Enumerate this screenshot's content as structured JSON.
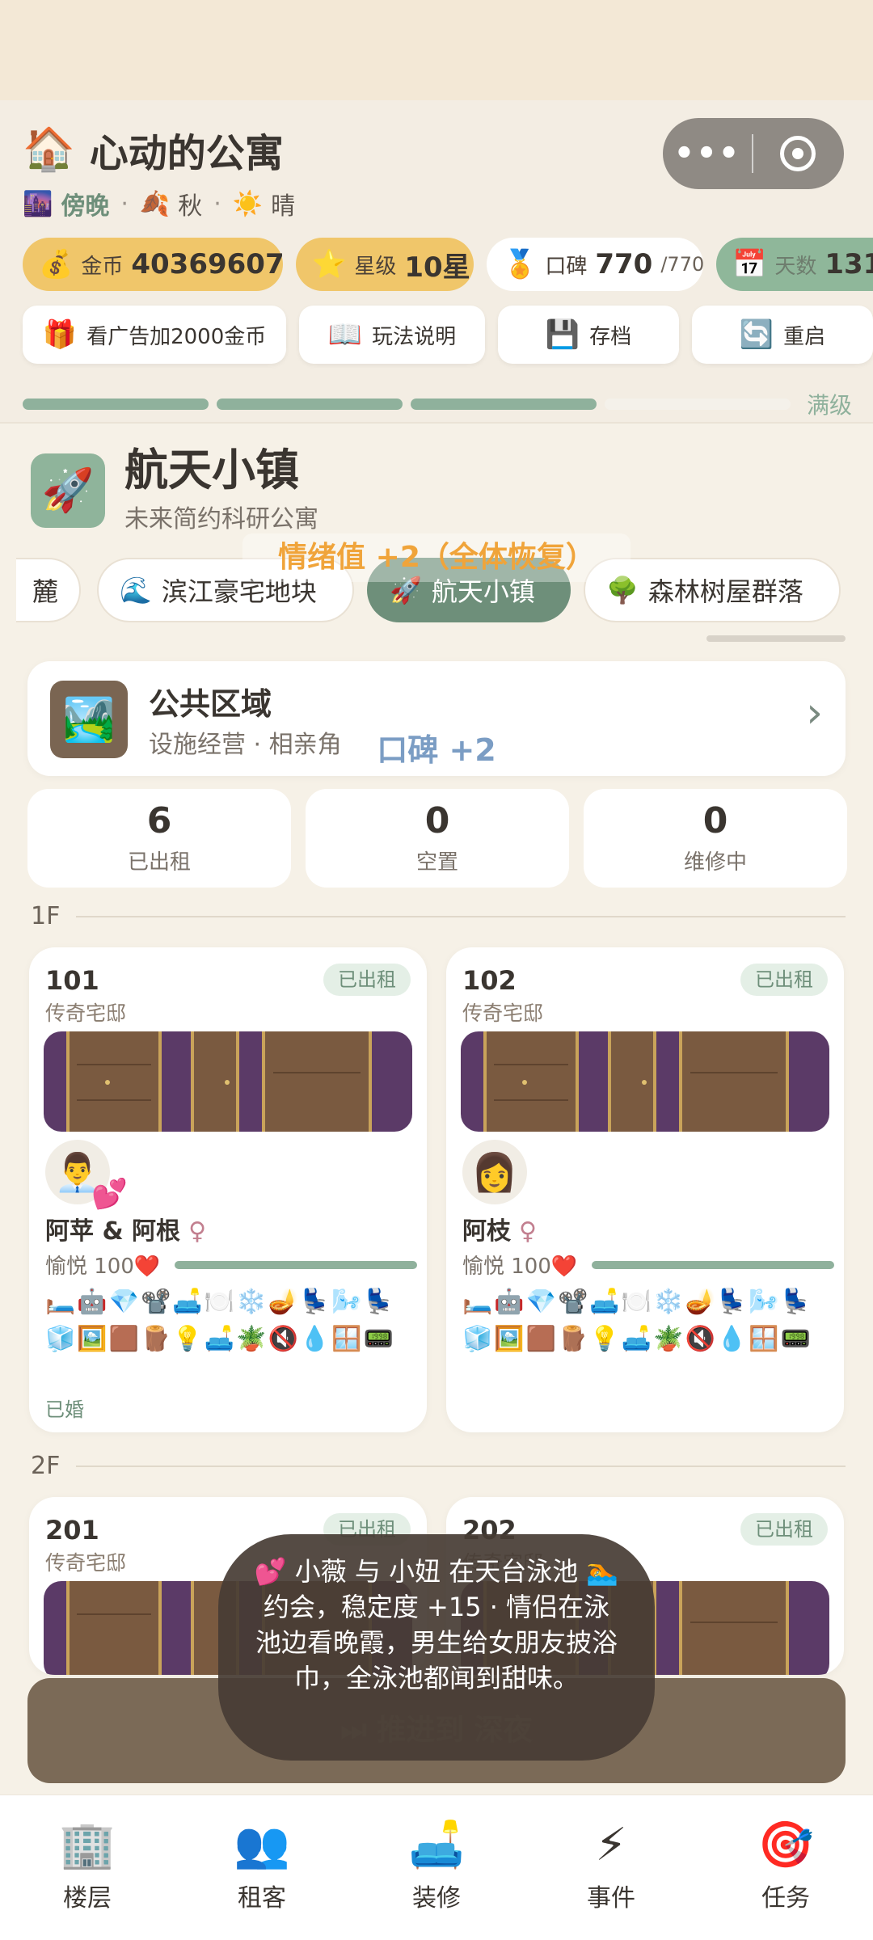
{
  "header": {
    "title": "心动的公寓",
    "time_of_day": "傍晚",
    "season": "秋",
    "weather": "晴"
  },
  "stats": {
    "gold": {
      "label": "金币",
      "value": "40369607"
    },
    "stars": {
      "label": "星级",
      "value": "10星"
    },
    "reputation": {
      "label": "口碑",
      "value": "770",
      "max": "/770"
    },
    "days": {
      "label": "天数",
      "value": "131"
    }
  },
  "actions": {
    "ad": "看广告加2000金币",
    "guide": "玩法说明",
    "save": "存档",
    "restart": "重启"
  },
  "progress": {
    "full_label": "满级",
    "filled_fraction": 0.75
  },
  "building": {
    "name": "航天小镇",
    "desc": "未来简约科研公寓"
  },
  "tabs": [
    {
      "label": "麓"
    },
    {
      "label": "滨江豪宅地块"
    },
    {
      "label": "航天小镇"
    },
    {
      "label": "森林树屋群落"
    }
  ],
  "float_emotion": "情绪值 +2（全体恢复）",
  "public_area": {
    "title": "公共区域",
    "desc": "设施经营 · 相亲角"
  },
  "float_reputation": "口碑 +2",
  "counts": [
    {
      "value": "6",
      "label": "已出租"
    },
    {
      "value": "0",
      "label": "空置"
    },
    {
      "value": "0",
      "label": "维修中"
    }
  ],
  "floors": [
    "1F",
    "2F"
  ],
  "rooms": [
    {
      "number": "101",
      "type": "传奇宅邸",
      "status": "已出租",
      "tenant": "阿苹 & 阿根",
      "gender": "♀",
      "mood": "愉悦 100❤️",
      "facilities": "🛏️🤖💎📽️🛋️🍽️❄️🪔💺🌬️💺🧊🖼️🟫🪵💡🛋️🪴🔇💧🪟📟",
      "married": "已婚"
    },
    {
      "number": "102",
      "type": "传奇宅邸",
      "status": "已出租",
      "tenant": "阿枝",
      "gender": "♀",
      "mood": "愉悦 100❤️",
      "facilities": "🛏️🤖💎📽️🛋️🍽️❄️🪔💺🌬️💺🧊🖼️🟫🪵💡🛋️🪴🔇💧🪟📟"
    },
    {
      "number": "201",
      "type": "传奇宅邸",
      "status": "已出租"
    },
    {
      "number": "202",
      "type": "传奇宅邸",
      "status": "已出租"
    }
  ],
  "fast_forward": "⏭ 推进到 深夜",
  "toast": "💕 小薇 与 小妞 在天台泳池 🏊 约会，稳定度 +15 · 情侣在泳池边看晚霞，男生给女朋友披浴巾，全泳池都闻到甜味。",
  "nav": [
    {
      "label": "楼层"
    },
    {
      "label": "租客"
    },
    {
      "label": "装修"
    },
    {
      "label": "事件"
    },
    {
      "label": "任务"
    }
  ]
}
